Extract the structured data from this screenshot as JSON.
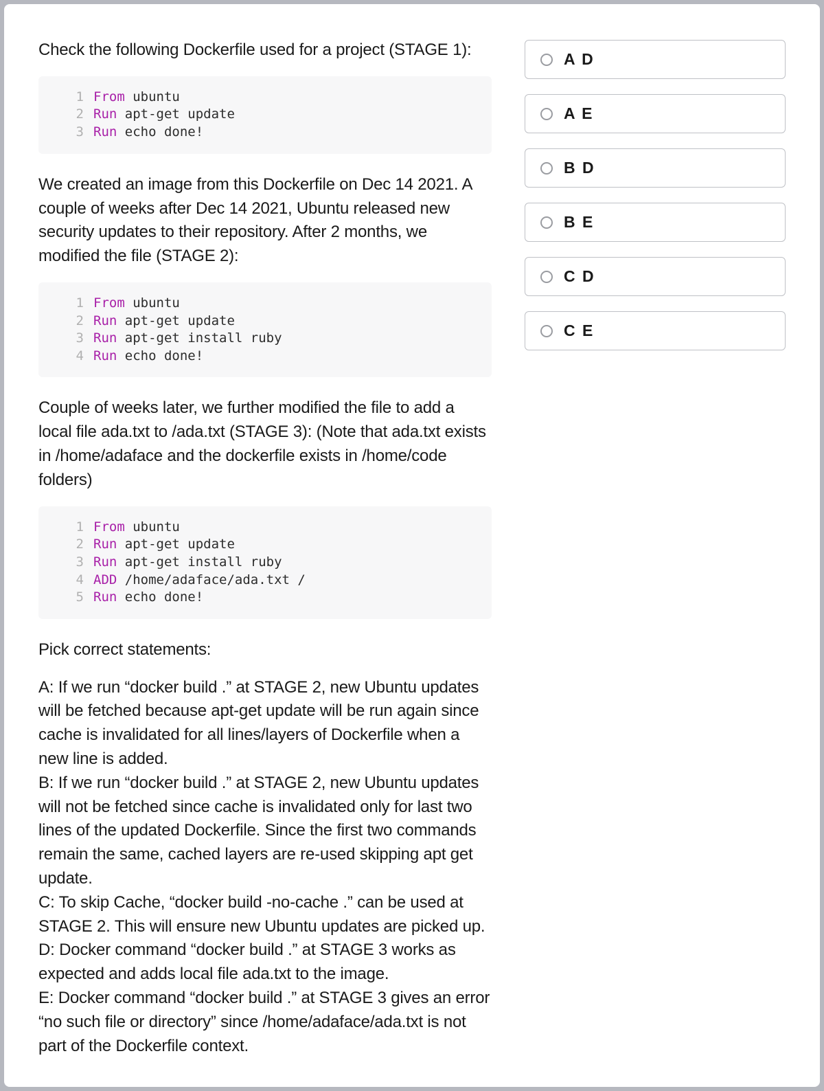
{
  "question": {
    "intro": "Check the following Dockerfile used for a project (STAGE 1):",
    "code1": [
      {
        "n": "1",
        "kw": "From",
        "rest": " ubuntu"
      },
      {
        "n": "2",
        "kw": "Run",
        "rest": " apt-get update"
      },
      {
        "n": "3",
        "kw": "Run",
        "rest": " echo done!"
      }
    ],
    "para2": "We created an image from this Dockerfile on Dec 14 2021. A couple of weeks after Dec 14 2021, Ubuntu released new security updates to their repository. After 2 months, we modified the file (STAGE 2):",
    "code2": [
      {
        "n": "1",
        "kw": "From",
        "rest": " ubuntu"
      },
      {
        "n": "2",
        "kw": "Run",
        "rest": " apt-get update"
      },
      {
        "n": "3",
        "kw": "Run",
        "rest": " apt-get install ruby"
      },
      {
        "n": "4",
        "kw": "Run",
        "rest": " echo done!"
      }
    ],
    "para3": "Couple of weeks later, we further modified the file to add a local file ada.txt to /ada.txt (STAGE 3): (Note that ada.txt exists in /home/adaface and the dockerfile exists in /home/code folders)",
    "code3": [
      {
        "n": "1",
        "kw": "From",
        "rest": " ubuntu"
      },
      {
        "n": "2",
        "kw": "Run",
        "rest": " apt-get update"
      },
      {
        "n": "3",
        "kw": "Run",
        "rest": " apt-get install ruby"
      },
      {
        "n": "4",
        "kw": "ADD",
        "rest": " /home/adaface/ada.txt /"
      },
      {
        "n": "5",
        "kw": "Run",
        "rest": " echo done!"
      }
    ],
    "pick_label": "Pick correct statements:",
    "statements": {
      "A": "A: If we run “docker build .” at STAGE 2, new Ubuntu updates will be fetched because apt-get update will be run again since cache is invalidated for all lines/layers of Dockerfile when a new line is added.",
      "B": "B: If we run “docker build .” at STAGE 2, new Ubuntu updates will not be fetched since cache is invalidated only for last two lines of the updated Dockerfile. Since the first two commands remain the same, cached layers are re-used skipping apt get update.",
      "C": "C: To skip Cache, “docker build -no-cache .” can be used at STAGE 2. This will ensure new Ubuntu updates are picked up.",
      "D": "D: Docker command “docker build .” at STAGE 3 works as expected and adds local file ada.txt to the image.",
      "E": "E: Docker command “docker build .” at STAGE 3 gives an error “no such file or directory” since /home/adaface/ada.txt is not part of the Dockerfile context."
    }
  },
  "options": [
    {
      "label": "A D"
    },
    {
      "label": "A E"
    },
    {
      "label": "B D"
    },
    {
      "label": "B E"
    },
    {
      "label": "C D"
    },
    {
      "label": "C E"
    }
  ]
}
